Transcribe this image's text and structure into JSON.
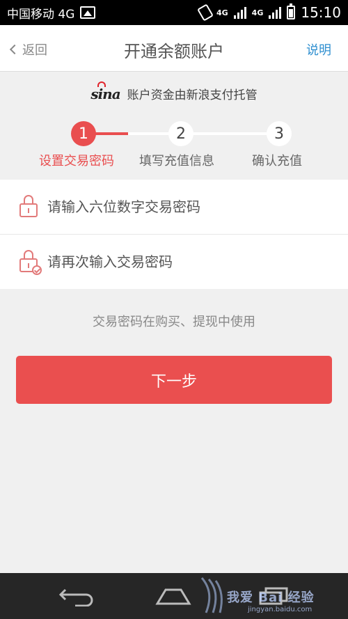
{
  "status_bar": {
    "carrier": "中国移动 4G",
    "network_tag_1": "4G",
    "network_tag_2": "4G",
    "time": "15:10"
  },
  "nav": {
    "back_label": "返回",
    "title": "开通余额账户",
    "help_label": "说明"
  },
  "sina": {
    "logo_text": "sina",
    "text": "账户资金由新浪支付托管"
  },
  "steps": [
    {
      "number": "1",
      "label": "设置交易密码",
      "active": true
    },
    {
      "number": "2",
      "label": "填写充值信息",
      "active": false
    },
    {
      "number": "3",
      "label": "确认充值",
      "active": false
    }
  ],
  "form": {
    "password_placeholder": "请输入六位数字交易密码",
    "password_value": "",
    "confirm_placeholder": "请再次输入交易密码",
    "confirm_value": ""
  },
  "hint": "交易密码在购买、提现中使用",
  "next_button_label": "下一步",
  "watermark": {
    "main": "我爱 Bai 经验",
    "sub": "jingyan.baidu.com"
  },
  "colors": {
    "accent": "#ea4f4f",
    "link": "#2f8fd0",
    "background": "#f0f0f0"
  },
  "icons": [
    "back-chevron-icon",
    "image-icon",
    "vibrate-icon",
    "signal-icon",
    "battery-icon",
    "sina-eye-icon",
    "lock-icon",
    "lock-check-icon",
    "system-back-icon",
    "system-home-icon",
    "system-recent-icon"
  ]
}
